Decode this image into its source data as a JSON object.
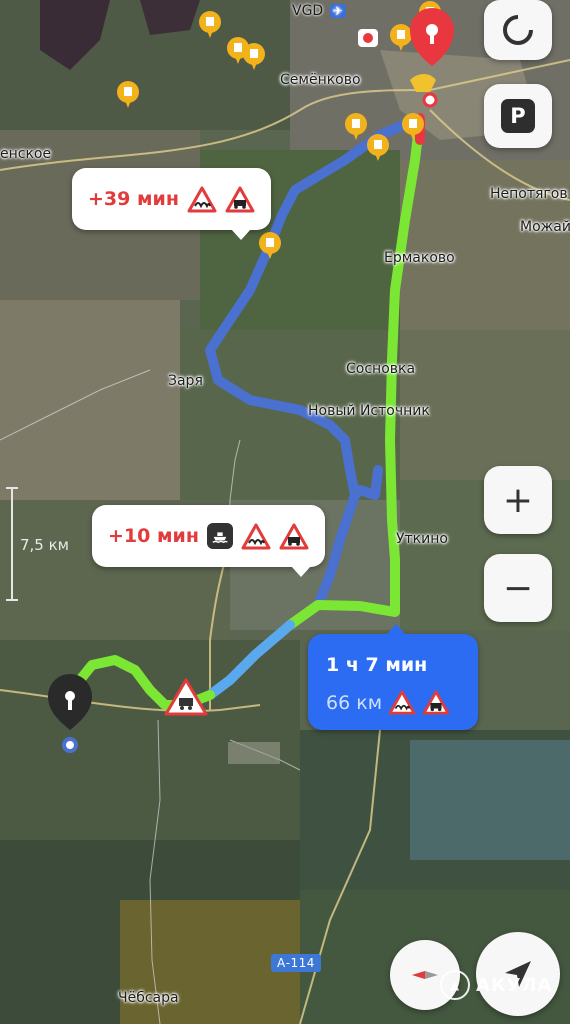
{
  "map": {
    "airport_label": "VGD",
    "places": [
      {
        "id": "semenkovo",
        "name": "Семёнково"
      },
      {
        "id": "enskoe",
        "name": "енское"
      },
      {
        "id": "nepotyagovo",
        "name": "Непотягов"
      },
      {
        "id": "mozhay",
        "name": "Можай"
      },
      {
        "id": "ermakovo",
        "name": "Ермаково"
      },
      {
        "id": "sosnovka",
        "name": "Сосновка"
      },
      {
        "id": "zarya",
        "name": "Заря"
      },
      {
        "id": "novy-istochnik",
        "name": "Новый Источник"
      },
      {
        "id": "utkino",
        "name": "Уткино"
      },
      {
        "id": "chebsara",
        "name": "Чёбсара"
      }
    ],
    "road_badge": "А-114",
    "scale": "7,5 км"
  },
  "alt_routes": [
    {
      "delay": "+39 мин"
    },
    {
      "delay": "+10 мин"
    }
  ],
  "selected_route": {
    "time": "1 ч 7 мин",
    "distance": "66 км"
  },
  "controls": {
    "zoom_in": "+",
    "zoom_out": "−",
    "parking": "P"
  },
  "watermark": "АКУЛА",
  "colors": {
    "route_main": "#4a70d0",
    "route_traffic_free": "#7ce634",
    "route_light": "#5aa8ee",
    "route_card": "#2b6cf2",
    "warning": "#e23b3b",
    "poi": "#f2b21b",
    "destination": "#e8373f"
  }
}
